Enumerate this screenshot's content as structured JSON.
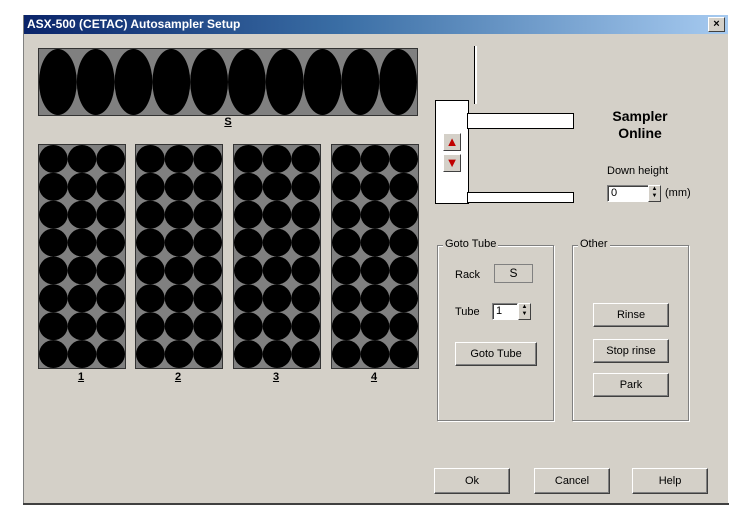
{
  "window": {
    "title": "ASX-500 (CETAC) Autosampler Setup",
    "close_glyph": "×"
  },
  "racks": {
    "standards": {
      "label": "S",
      "columns": 10,
      "rows": 1
    },
    "sample_racks": [
      {
        "label": "1",
        "columns": 3,
        "rows": 8
      },
      {
        "label": "2",
        "columns": 3,
        "rows": 8
      },
      {
        "label": "3",
        "columns": 3,
        "rows": 8
      },
      {
        "label": "4",
        "columns": 3,
        "rows": 8
      }
    ],
    "tube_color": "#000000",
    "rack_color": "#808080"
  },
  "sampler": {
    "status_line1": "Sampler",
    "status_line2": "Online",
    "up_arrow": "▲",
    "down_arrow": "▼",
    "arrow_color": "#c00000",
    "down_height_label": "Down height",
    "down_height_value": "0",
    "down_height_unit": "(mm)"
  },
  "goto_tube": {
    "group_label": "Goto Tube",
    "rack_label": "Rack",
    "rack_value": "S",
    "tube_label": "Tube",
    "tube_value": "1",
    "button_label": "Goto Tube"
  },
  "other": {
    "group_label": "Other",
    "rinse_label": "Rinse",
    "stop_rinse_label": "Stop rinse",
    "park_label": "Park"
  },
  "footer": {
    "ok_label": "Ok",
    "cancel_label": "Cancel",
    "help_label": "Help"
  }
}
